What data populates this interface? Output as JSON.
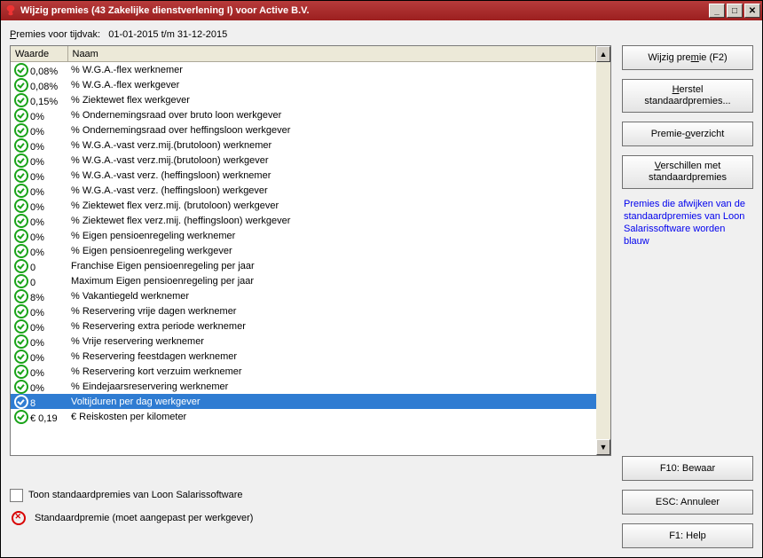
{
  "title": "Wijzig premies (43 Zakelijke dienstverlening I) voor Active B.V.",
  "period_label": "Premies voor tijdvak:",
  "period_value": "01-01-2015 t/m 31-12-2015",
  "columns": {
    "value": "Waarde",
    "name": "Naam"
  },
  "rows": [
    {
      "v": "0,08%",
      "n": "% W.G.A.-flex werknemer",
      "sel": false
    },
    {
      "v": "0,08%",
      "n": "% W.G.A.-flex werkgever",
      "sel": false
    },
    {
      "v": "0,15%",
      "n": "% Ziektewet flex werkgever",
      "sel": false
    },
    {
      "v": "0%",
      "n": "% Ondernemingsraad over bruto loon werkgever",
      "sel": false
    },
    {
      "v": "0%",
      "n": "% Ondernemingsraad over heffingsloon werkgever",
      "sel": false
    },
    {
      "v": "0%",
      "n": "% W.G.A.-vast verz.mij.(brutoloon) werknemer",
      "sel": false
    },
    {
      "v": "0%",
      "n": "% W.G.A.-vast verz.mij.(brutoloon) werkgever",
      "sel": false
    },
    {
      "v": "0%",
      "n": "% W.G.A.-vast verz. (heffingsloon) werknemer",
      "sel": false
    },
    {
      "v": "0%",
      "n": "% W.G.A.-vast verz. (heffingsloon) werkgever",
      "sel": false
    },
    {
      "v": "0%",
      "n": "% Ziektewet flex verz.mij. (brutoloon) werkgever",
      "sel": false
    },
    {
      "v": "0%",
      "n": "% Ziektewet flex verz.mij. (heffingsloon) werkgever",
      "sel": false
    },
    {
      "v": "0%",
      "n": "% Eigen pensioenregeling werknemer",
      "sel": false
    },
    {
      "v": "0%",
      "n": "% Eigen pensioenregeling werkgever",
      "sel": false
    },
    {
      "v": "0",
      "n": "Franchise Eigen pensioenregeling per jaar",
      "sel": false
    },
    {
      "v": "0",
      "n": "Maximum Eigen pensioenregeling per jaar",
      "sel": false
    },
    {
      "v": "8%",
      "n": "% Vakantiegeld werknemer",
      "sel": false
    },
    {
      "v": "0%",
      "n": "% Reservering vrije dagen werknemer",
      "sel": false
    },
    {
      "v": "0%",
      "n": "% Reservering extra periode werknemer",
      "sel": false
    },
    {
      "v": "0%",
      "n": "% Vrije reservering werknemer",
      "sel": false
    },
    {
      "v": "0%",
      "n": "% Reservering feestdagen werknemer",
      "sel": false
    },
    {
      "v": "0%",
      "n": "% Reservering kort verzuim werknemer",
      "sel": false
    },
    {
      "v": "0%",
      "n": "% Eindejaarsreservering werknemer",
      "sel": false
    },
    {
      "v": "8",
      "n": "Voltijduren per dag werkgever",
      "sel": true
    },
    {
      "v": "€ 0,19",
      "n": "€ Reiskosten per kilometer",
      "sel": false
    }
  ],
  "sidebar": {
    "wijzig_pre": "Wijzig pre",
    "wijzig_key": "m",
    "wijzig_suf": "ie (F2)",
    "herstel_pre": "",
    "herstel_key": "H",
    "herstel_suf": "erstel",
    "herstel_line2": "standaardpremies...",
    "overzicht_pre": "Premie-",
    "overzicht_key": "o",
    "overzicht_suf": "verzicht",
    "verschil_pre": "",
    "verschil_key": "V",
    "verschil_suf": "erschillen met",
    "verschil_line2": "standaardpremies",
    "note": "Premies die afwijken van de standaardpremies van Loon Salarissoftware worden blauw"
  },
  "bottom": {
    "checkbox_pre": "",
    "checkbox_key": "T",
    "checkbox_suf": "oon standaardpremies van Loon Salarissoftware",
    "legend": "Standaardpremie (moet aangepast per werkgever)",
    "save": "F10: Bewaar",
    "cancel": "ESC: Annuleer",
    "help": "F1: Help"
  }
}
